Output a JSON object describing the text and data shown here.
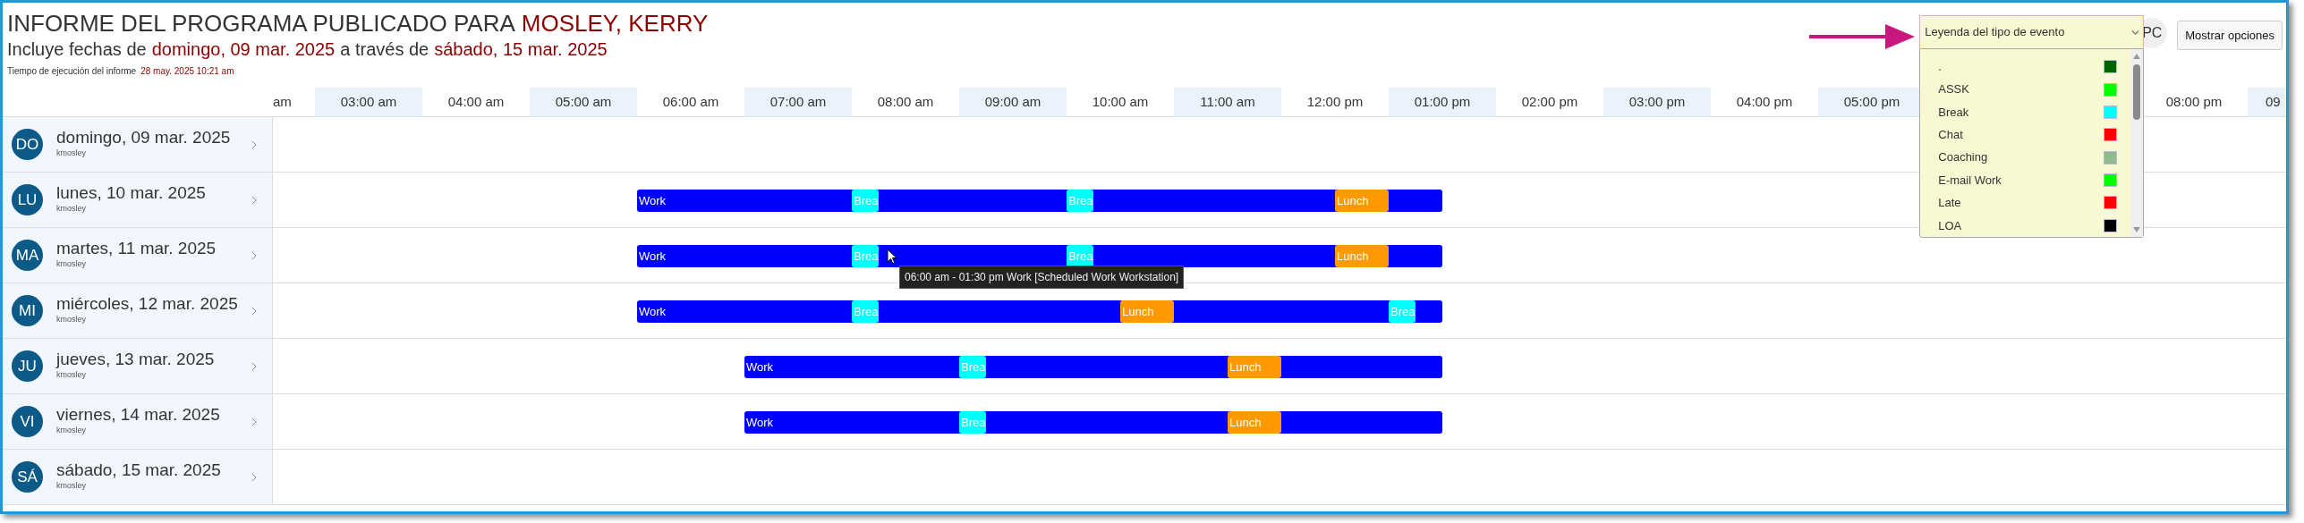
{
  "report": {
    "title": "INFORME DEL PROGRAMA PUBLICADO PARA",
    "person": "MOSLEY, KERRY",
    "range_prefix": "Incluye fechas de",
    "range_start": "domingo, 09 mar. 2025",
    "range_join": "a través de",
    "range_end": "sábado, 15 mar. 2025",
    "run_label": "Tiempo de ejecución del informe",
    "run_time": "28 may. 2025 10:21 am"
  },
  "legend": {
    "label": "Leyenda del tipo de evento",
    "expanded": true,
    "items": [
      {
        "label": ".",
        "color": "#006400"
      },
      {
        "label": "ASSK",
        "color": "#00ff00"
      },
      {
        "label": "Break",
        "color": "#00ffff"
      },
      {
        "label": "Chat",
        "color": "#ff0000"
      },
      {
        "label": "Coaching",
        "color": "#8fbc8f"
      },
      {
        "label": "E-mail Work",
        "color": "#00ff00"
      },
      {
        "label": "Late",
        "color": "#ff0000"
      },
      {
        "label": "LOA",
        "color": "#000000"
      }
    ]
  },
  "user_badge": "PC",
  "options_button": "Mostrar opciones",
  "hours": [
    "am",
    "03:00 am",
    "04:00 am",
    "05:00 am",
    "06:00 am",
    "07:00 am",
    "08:00 am",
    "09:00 am",
    "10:00 am",
    "11:00 am",
    "12:00 pm",
    "01:00 pm",
    "02:00 pm",
    "03:00 pm",
    "04:00 pm",
    "05:00 pm",
    "08:00 pm",
    "09"
  ],
  "days": [
    {
      "initials": "DO",
      "date": "domingo, 09 mar. 2025",
      "user": "kmosley"
    },
    {
      "initials": "LU",
      "date": "lunes, 10 mar. 2025",
      "user": "kmosley",
      "events": [
        {
          "label": "Work",
          "color": "#0000ff"
        },
        {
          "label": "Brea",
          "color": "#00ffff"
        },
        {
          "label": "Brea",
          "color": "#00ffff"
        },
        {
          "label": "Lunch",
          "color": "#ff9900"
        }
      ]
    },
    {
      "initials": "MA",
      "date": "martes, 11 mar. 2025",
      "user": "kmosley",
      "events": [
        {
          "label": "Work",
          "color": "#0000ff"
        },
        {
          "label": "Brea",
          "color": "#00ffff"
        },
        {
          "label": "Brea",
          "color": "#00ffff"
        },
        {
          "label": "Lunch",
          "color": "#ff9900"
        }
      ]
    },
    {
      "initials": "MI",
      "date": "miércoles, 12 mar. 2025",
      "user": "kmosley",
      "events": [
        {
          "label": "Work",
          "color": "#0000ff"
        },
        {
          "label": "Brea",
          "color": "#00ffff"
        },
        {
          "label": "Lunch",
          "color": "#ff9900"
        },
        {
          "label": "Brea",
          "color": "#00ffff"
        }
      ]
    },
    {
      "initials": "JU",
      "date": "jueves, 13 mar. 2025",
      "user": "kmosley",
      "events": [
        {
          "label": "Work",
          "color": "#0000ff"
        },
        {
          "label": "Brea",
          "color": "#00ffff"
        },
        {
          "label": "Lunch",
          "color": "#ff9900"
        }
      ]
    },
    {
      "initials": "VI",
      "date": "viernes, 14 mar. 2025",
      "user": "kmosley",
      "events": [
        {
          "label": "Work",
          "color": "#0000ff"
        },
        {
          "label": "Brea",
          "color": "#00ffff"
        },
        {
          "label": "Lunch",
          "color": "#ff9900"
        }
      ]
    },
    {
      "initials": "SÁ",
      "date": "sábado, 15 mar. 2025",
      "user": "kmosley"
    }
  ],
  "tooltip": {
    "text": "06:00 am - 01:30 pm Work [Scheduled Work Workstation]"
  }
}
